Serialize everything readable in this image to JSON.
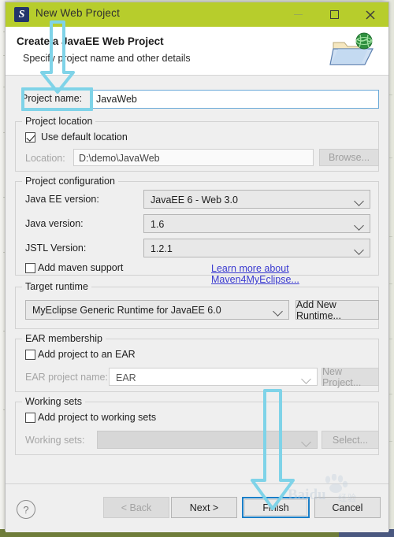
{
  "window": {
    "title": "New Web Project",
    "app_icon": "myeclipse-logo-icon",
    "minimize_label": "–",
    "maximize_label": "□",
    "close_label": "✕"
  },
  "header": {
    "title": "Create a JavaEE Web Project",
    "subtitle": "Specify project name and other details",
    "icon": "web-project-folder-globe-icon"
  },
  "project_name": {
    "label": "Project name:",
    "value": "JavaWeb",
    "highlighted": true
  },
  "project_location": {
    "legend": "Project location",
    "use_default_label": "Use default location",
    "use_default_checked": true,
    "location_label": "Location:",
    "location_value": "D:\\demo\\JavaWeb",
    "browse_label": "Browse..."
  },
  "project_configuration": {
    "legend": "Project configuration",
    "javaee_label": "Java EE version:",
    "javaee_value": "JavaEE 6 - Web 3.0",
    "java_label": "Java version:",
    "java_value": "1.6",
    "jstl_label": "JSTL Version:",
    "jstl_value": "1.2.1",
    "maven_label": "Add maven support",
    "maven_checked": false,
    "maven_link": "Learn more about Maven4MyEclipse..."
  },
  "target_runtime": {
    "legend": "Target runtime",
    "runtime_value": "MyEclipse Generic Runtime for JavaEE 6.0",
    "add_runtime_label": "Add New Runtime..."
  },
  "ear_membership": {
    "legend": "EAR membership",
    "add_to_ear_label": "Add project to an EAR",
    "add_to_ear_checked": false,
    "ear_name_label": "EAR project name:",
    "ear_name_value": "EAR",
    "new_project_label": "New Project..."
  },
  "working_sets": {
    "legend": "Working sets",
    "add_to_ws_label": "Add project to working sets",
    "add_to_ws_checked": false,
    "ws_label": "Working sets:",
    "ws_value": "",
    "select_label": "Select..."
  },
  "footer": {
    "help_label": "?",
    "back_label": "< Back",
    "next_label": "Next >",
    "finish_label": "Finish",
    "cancel_label": "Cancel"
  },
  "annotations": {
    "arrow_top": "down-arrow-to-project-name",
    "arrow_bottom": "down-arrow-to-finish-button",
    "accent_color": "#7fd3e8",
    "titlebar_color": "#b7cd2c",
    "focus_color": "#1a7fc8",
    "link_color": "#3a3ad0"
  },
  "watermark": {
    "brand": "Baidu",
    "sub": "经验"
  }
}
